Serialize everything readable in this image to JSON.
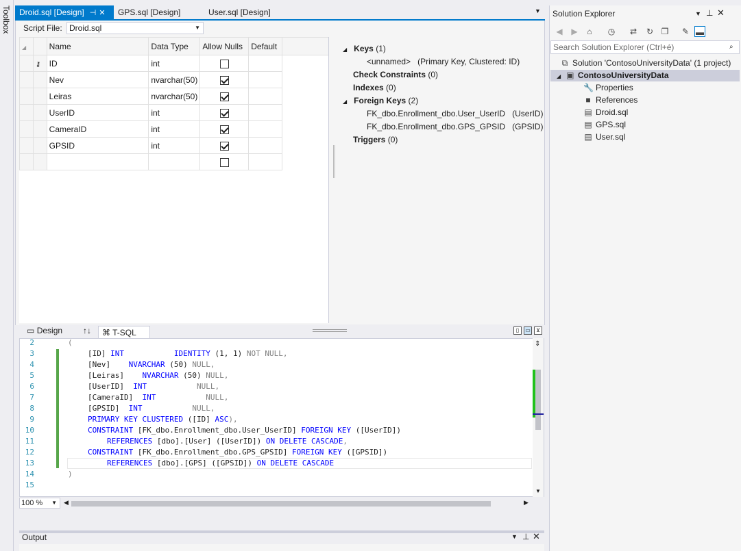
{
  "toolbox": {
    "label": "Toolbox"
  },
  "tabs": [
    {
      "label": "Droid.sql [Design]",
      "active": true
    },
    {
      "label": "GPS.sql [Design]",
      "active": false
    },
    {
      "label": "User.sql [Design]",
      "active": false
    }
  ],
  "script_file": {
    "label": "Script File:",
    "value": "Droid.sql"
  },
  "grid": {
    "headers": [
      "Name",
      "Data Type",
      "Allow Nulls",
      "Default"
    ],
    "rows": [
      {
        "name": "ID",
        "type": "int",
        "nulls": false,
        "pk": true
      },
      {
        "name": "Nev",
        "type": "nvarchar(50)",
        "nulls": true
      },
      {
        "name": "Leiras",
        "type": "nvarchar(50)",
        "nulls": true
      },
      {
        "name": "UserID",
        "type": "int",
        "nulls": true
      },
      {
        "name": "CameraID",
        "type": "int",
        "nulls": true
      },
      {
        "name": "GPSID",
        "type": "int",
        "nulls": true
      },
      {
        "name": "",
        "type": "",
        "nulls": false
      }
    ]
  },
  "keys": {
    "keys_label": "Keys",
    "keys_count": "(1)",
    "pk_name": "<unnamed>",
    "pk_desc": "(Primary Key, Clustered: ID)",
    "check_label": "Check Constraints",
    "check_count": "(0)",
    "indexes_label": "Indexes",
    "indexes_count": "(0)",
    "fk_label": "Foreign Keys",
    "fk_count": "(2)",
    "fk1_name": "FK_dbo.Enrollment_dbo.User_UserID",
    "fk1_col": "(UserID)",
    "fk2_name": "FK_dbo.Enrollment_dbo.GPS_GPSID",
    "fk2_col": "(GPSID)",
    "triggers_label": "Triggers",
    "triggers_count": "(0)"
  },
  "pane_tabs": {
    "design": "Design",
    "swap": "↑↓",
    "tsql": "T-SQL"
  },
  "code_lines": [
    {
      "n": "2",
      "text": "("
    },
    {
      "n": "3"
    },
    {
      "n": "4"
    },
    {
      "n": "5"
    },
    {
      "n": "6"
    },
    {
      "n": "7"
    },
    {
      "n": "8"
    },
    {
      "n": "9"
    },
    {
      "n": "10"
    },
    {
      "n": "11"
    },
    {
      "n": "12"
    },
    {
      "n": "13"
    },
    {
      "n": "14",
      "text": ")"
    },
    {
      "n": "15",
      "text": ""
    }
  ],
  "code": {
    "l3a": "[ID]",
    "l3b": "INT",
    "l3c": "IDENTITY",
    "l3d": "(1, 1)",
    "l3e": "NOT NULL,",
    "l4a": "[Nev]",
    "l4b": "NVARCHAR",
    "l4c": "(50)",
    "l4d": "NULL,",
    "l5a": "[Leiras]",
    "l5b": "NVARCHAR",
    "l5c": "(50)",
    "l5d": "NULL,",
    "l6a": "[UserID]",
    "l6b": "INT",
    "l6c": "NULL,",
    "l7a": "[CameraID]",
    "l7b": "INT",
    "l7c": "NULL,",
    "l8a": "[GPSID]",
    "l8b": "INT",
    "l8c": "NULL,",
    "l9a": "PRIMARY KEY CLUSTERED",
    "l9b": "([ID]",
    "l9c": "ASC",
    "l9d": "),",
    "l10a": "CONSTRAINT",
    "l10b": "[FK_dbo.Enrollment_dbo.User_UserID]",
    "l10c": "FOREIGN KEY",
    "l10d": "([UserID])",
    "l11a": "REFERENCES",
    "l11b": "[dbo].[User]",
    "l11c": "([UserID])",
    "l11d": "ON DELETE CASCADE",
    "l11e": ",",
    "l12a": "CONSTRAINT",
    "l12b": "[FK_dbo.Enrollment_dbo.GPS_GPSID]",
    "l12c": "FOREIGN KEY",
    "l12d": "([GPSID])",
    "l13a": "REFERENCES",
    "l13b": "[dbo].[GPS]",
    "l13c": "([GPSID])",
    "l13d": "ON DELETE CASCADE"
  },
  "zoom": "100 %",
  "output": {
    "title": "Output"
  },
  "solution": {
    "title": "Solution Explorer",
    "search_placeholder": "Search Solution Explorer (Ctrl+é)",
    "solution_label": "Solution 'ContosoUniversityData' (1 project)",
    "project": "ContosoUniversityData",
    "items": [
      "Properties",
      "References",
      "Droid.sql",
      "GPS.sql",
      "User.sql"
    ]
  }
}
